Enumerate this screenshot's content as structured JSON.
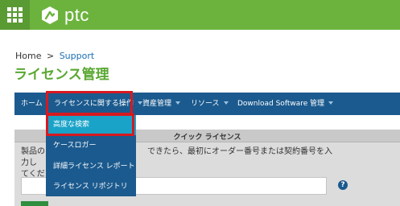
{
  "header": {
    "apps_icon": "grid-icon",
    "logo_text": "ptc",
    "brand_color": "#6cb33e"
  },
  "breadcrumb": {
    "home": "Home",
    "separator": ">",
    "current": "Support"
  },
  "page_title": "ライセンス管理",
  "nav": {
    "items": [
      {
        "label": "ホーム",
        "has_caret": false
      },
      {
        "label": "ライセンスに関する操作",
        "has_caret": true
      },
      {
        "label": "資産管理",
        "has_caret": true
      },
      {
        "label": "リソース",
        "has_caret": true
      },
      {
        "label": "Download Software",
        "has_caret": false
      },
      {
        "label": "管理",
        "has_caret": true
      }
    ],
    "color": "#1b5a8e"
  },
  "dropdown": {
    "items": [
      {
        "label": "高度な検索",
        "active": true
      },
      {
        "label": "ケースロガー",
        "active": false
      },
      {
        "label": "詳細ライセンス レポート",
        "active": false
      },
      {
        "label": "ライセンス リポジトリ",
        "active": false
      }
    ],
    "active_color": "#1aa3c8"
  },
  "panel": {
    "title": "クイック ライセンス",
    "instruction_line1_a": "製品のラ",
    "instruction_line1_b": "できたら、最初にオーダー番号または契約番号を入力し",
    "instruction_line2": "てくださ",
    "help_icon": "question-icon"
  },
  "highlight_color": "#d71920"
}
